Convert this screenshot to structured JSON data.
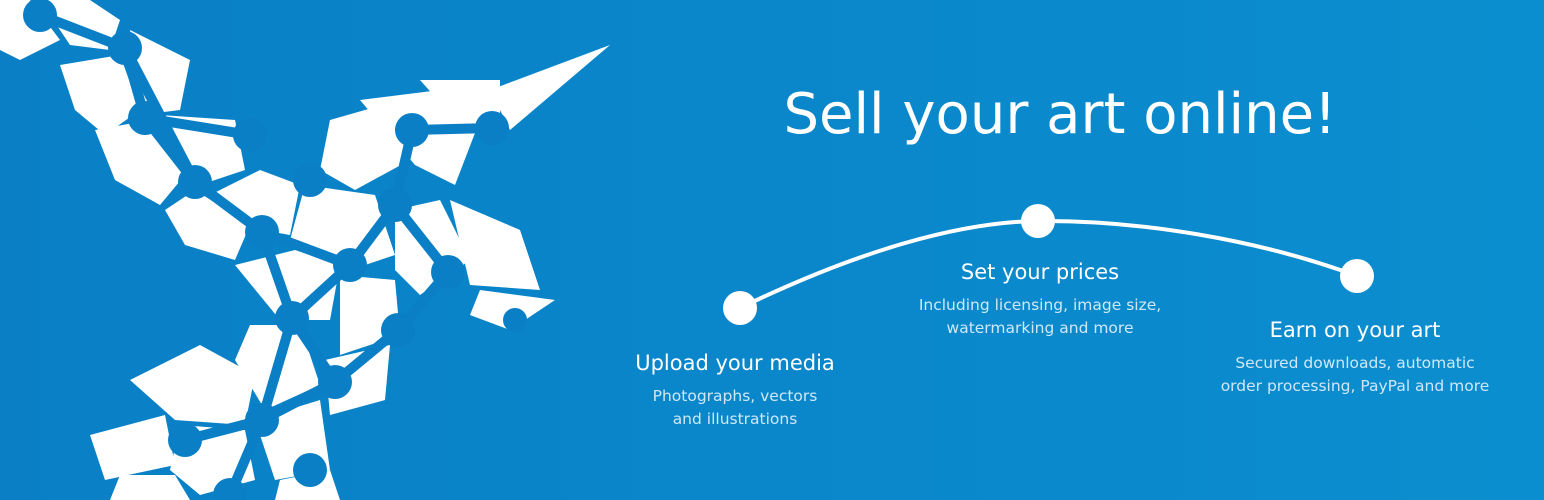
{
  "banner": {
    "headline": "Sell your art online!",
    "background_color": "#0a86ca",
    "accent_color": "#ffffff",
    "logo_icon": "geometric-hummingbird-icon"
  },
  "steps": [
    {
      "title": "Upload your media",
      "description": "Photographs, vectors\nand illustrations"
    },
    {
      "title": "Set your prices",
      "description": "Including licensing, image size,\nwatermarking and more"
    },
    {
      "title": "Earn on your art",
      "description": "Secured downloads, automatic\norder processing, PayPal and more"
    }
  ]
}
